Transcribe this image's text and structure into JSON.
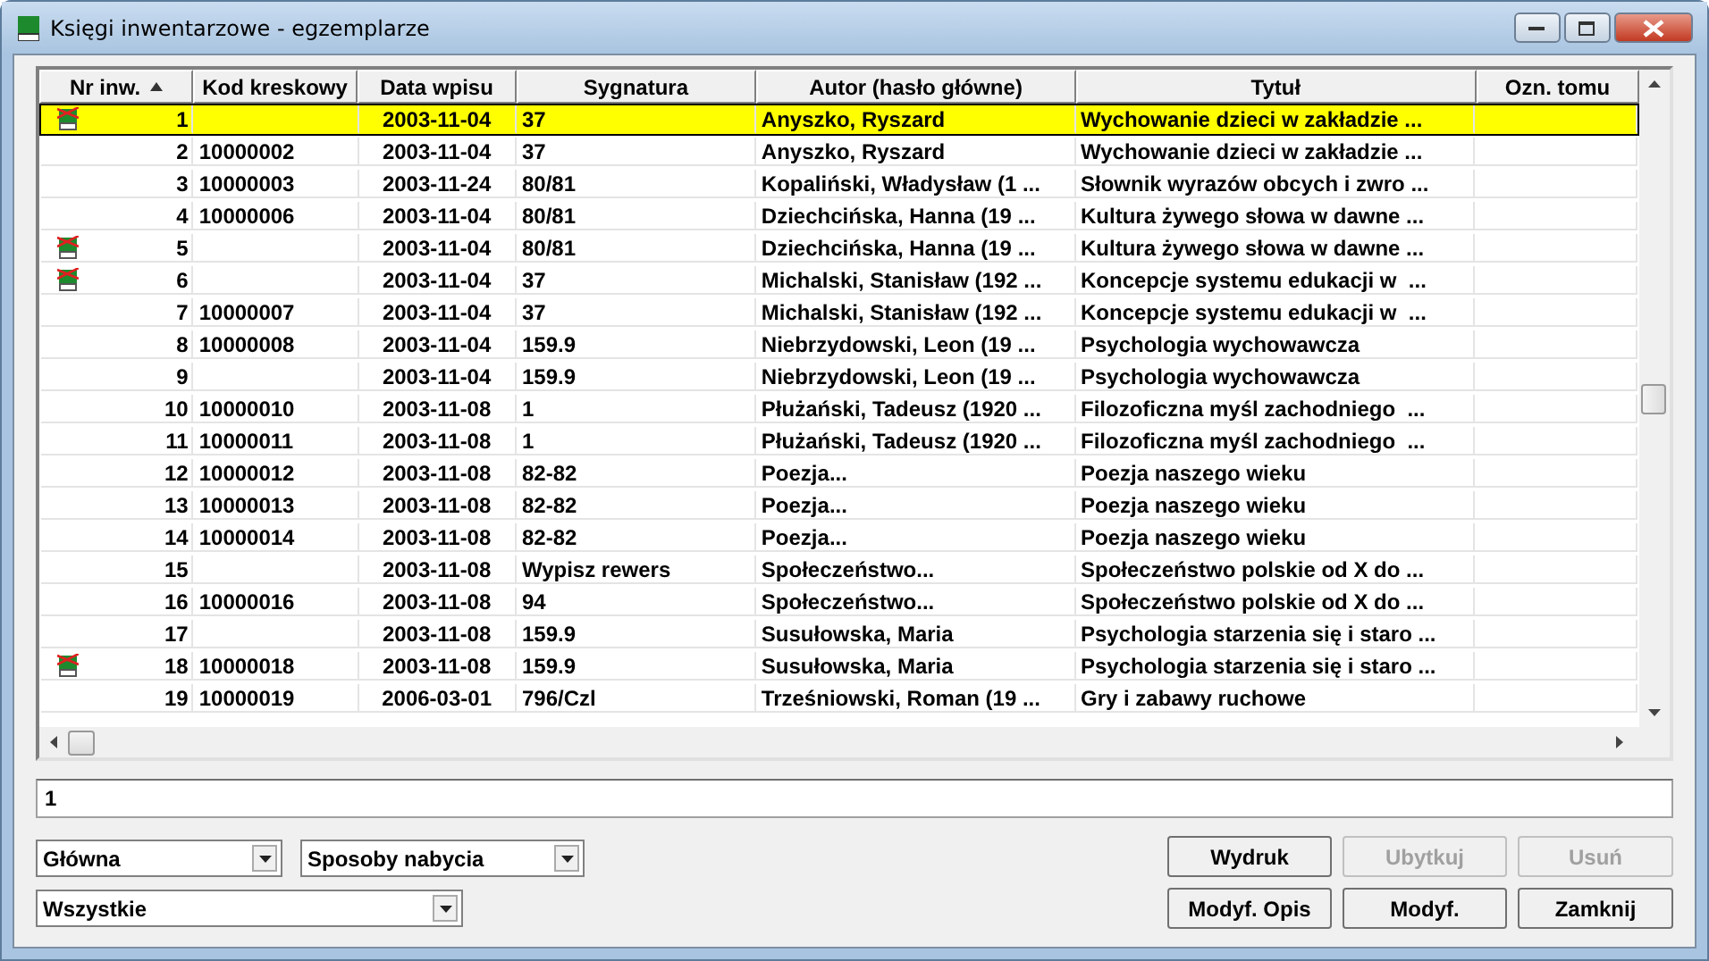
{
  "window": {
    "title": "Księgi inwentarzowe - egzemplarze"
  },
  "table": {
    "columns": [
      {
        "label": "Nr inw.",
        "sorted": true
      },
      {
        "label": "Kod kreskowy",
        "sorted": false
      },
      {
        "label": "Data wpisu",
        "sorted": false
      },
      {
        "label": "Sygnatura",
        "sorted": false
      },
      {
        "label": "Autor (hasło główne)",
        "sorted": false
      },
      {
        "label": "Tytuł",
        "sorted": false
      },
      {
        "label": "Ozn. tomu",
        "sorted": false
      }
    ],
    "rows": [
      {
        "marked": true,
        "selected": true,
        "cells": [
          "1",
          "",
          "2003-11-04",
          "37",
          "Anyszko, Ryszard",
          "Wychowanie dzieci w zakładzie ..."
        ]
      },
      {
        "marked": false,
        "selected": false,
        "cells": [
          "2",
          "10000002",
          "2003-11-04",
          "37",
          "Anyszko, Ryszard",
          "Wychowanie dzieci w zakładzie ..."
        ]
      },
      {
        "marked": false,
        "selected": false,
        "cells": [
          "3",
          "10000003",
          "2003-11-24",
          "80/81",
          "Kopaliński, Władysław (1 ...",
          "Słownik wyrazów obcych i zwro ..."
        ]
      },
      {
        "marked": false,
        "selected": false,
        "cells": [
          "4",
          "10000006",
          "2003-11-04",
          "80/81",
          "Dziechcińska, Hanna (19 ...",
          "Kultura żywego słowa w dawne ..."
        ]
      },
      {
        "marked": true,
        "selected": false,
        "cells": [
          "5",
          "",
          "2003-11-04",
          "80/81",
          "Dziechcińska, Hanna (19 ...",
          "Kultura żywego słowa w dawne ..."
        ]
      },
      {
        "marked": true,
        "selected": false,
        "cells": [
          "6",
          "",
          "2003-11-04",
          "37",
          "Michalski, Stanisław (192 ...",
          "Koncepcje systemu edukacji w  ..."
        ]
      },
      {
        "marked": false,
        "selected": false,
        "cells": [
          "7",
          "10000007",
          "2003-11-04",
          "37",
          "Michalski, Stanisław (192 ...",
          "Koncepcje systemu edukacji w  ..."
        ]
      },
      {
        "marked": false,
        "selected": false,
        "cells": [
          "8",
          "10000008",
          "2003-11-04",
          "159.9",
          "Niebrzydowski, Leon (19 ...",
          "Psychologia wychowawcza"
        ]
      },
      {
        "marked": false,
        "selected": false,
        "cells": [
          "9",
          "",
          "2003-11-04",
          "159.9",
          "Niebrzydowski, Leon (19 ...",
          "Psychologia wychowawcza"
        ]
      },
      {
        "marked": false,
        "selected": false,
        "cells": [
          "10",
          "10000010",
          "2003-11-08",
          "1",
          "Płużański, Tadeusz (1920 ...",
          "Filozoficzna myśl zachodniego  ..."
        ]
      },
      {
        "marked": false,
        "selected": false,
        "cells": [
          "11",
          "10000011",
          "2003-11-08",
          "1",
          "Płużański, Tadeusz (1920 ...",
          "Filozoficzna myśl zachodniego  ..."
        ]
      },
      {
        "marked": false,
        "selected": false,
        "cells": [
          "12",
          "10000012",
          "2003-11-08",
          "82-82",
          "Poezja...",
          "Poezja naszego wieku"
        ]
      },
      {
        "marked": false,
        "selected": false,
        "cells": [
          "13",
          "10000013",
          "2003-11-08",
          "82-82",
          "Poezja...",
          "Poezja naszego wieku"
        ]
      },
      {
        "marked": false,
        "selected": false,
        "cells": [
          "14",
          "10000014",
          "2003-11-08",
          "82-82",
          "Poezja...",
          "Poezja naszego wieku"
        ]
      },
      {
        "marked": false,
        "selected": false,
        "cells": [
          "15",
          "",
          "2003-11-08",
          "Wypisz rewers",
          "Społeczeństwo...",
          "Społeczeństwo polskie od X do ..."
        ]
      },
      {
        "marked": false,
        "selected": false,
        "cells": [
          "16",
          "10000016",
          "2003-11-08",
          "94",
          "Społeczeństwo...",
          "Społeczeństwo polskie od X do ..."
        ]
      },
      {
        "marked": false,
        "selected": false,
        "cells": [
          "17",
          "",
          "2003-11-08",
          "159.9",
          "Susułowska, Maria",
          "Psychologia starzenia się i staro ..."
        ]
      },
      {
        "marked": true,
        "selected": false,
        "cells": [
          "18",
          "10000018",
          "2003-11-08",
          "159.9",
          "Susułowska, Maria",
          "Psychologia starzenia się i staro ..."
        ]
      },
      {
        "marked": false,
        "selected": false,
        "cells": [
          "19",
          "10000019",
          "2006-03-01",
          "796/Czl",
          "Trześniowski, Roman (19 ...",
          "Gry i zabawy ruchowe"
        ]
      }
    ]
  },
  "search": {
    "value": "1"
  },
  "dropdowns": [
    {
      "value": "Główna"
    },
    {
      "value": "Sposoby nabycia"
    },
    {
      "value": "Wszystkie"
    }
  ],
  "buttons": [
    {
      "label": "Wydruk",
      "disabled": false
    },
    {
      "label": "Ubytkuj",
      "disabled": true
    },
    {
      "label": "Usuń",
      "disabled": true
    },
    {
      "label": "Modyf. Opis",
      "disabled": false
    },
    {
      "label": "Modyf.",
      "disabled": false
    },
    {
      "label": "Zamknij",
      "disabled": false
    }
  ]
}
